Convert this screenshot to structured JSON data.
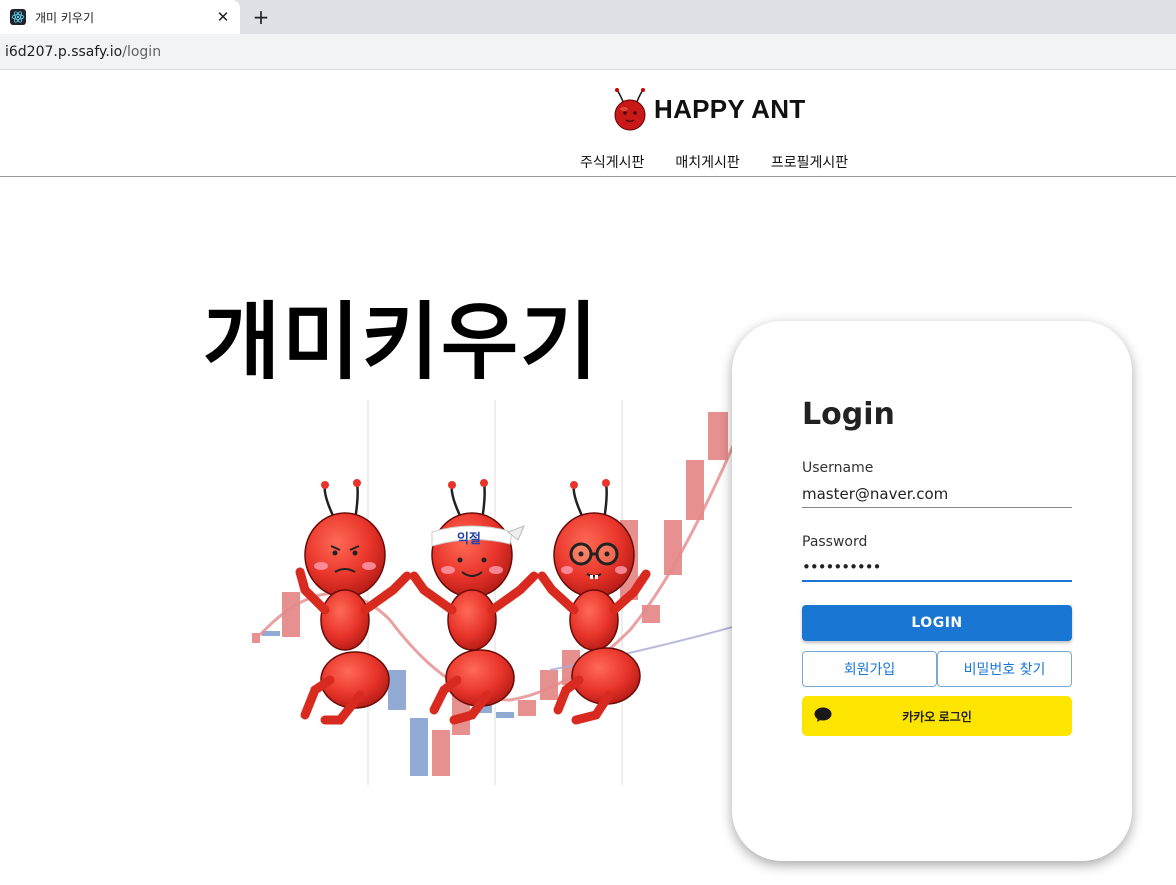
{
  "browser": {
    "tab_title": "개미 키우기",
    "tab_close": "✕",
    "new_tab": "+",
    "url_host": "i6d207.p.ssafy.io",
    "url_path": "/login"
  },
  "header": {
    "brand": "HAPPY ANT",
    "nav": [
      "주식게시판",
      "매치게시판",
      "프로필게시판"
    ]
  },
  "hero": {
    "title": "개미키우기",
    "headband_text": "익절"
  },
  "login": {
    "title": "Login",
    "username_label": "Username",
    "username_value": "master@naver.com",
    "password_label": "Password",
    "password_value": "••••••••••",
    "login_button": "LOGIN",
    "signup_button": "회원가입",
    "find_password_button": "비밀번호 찾기",
    "kakao_button": "카카오 로그인"
  },
  "colors": {
    "primary": "#1976d2",
    "kakao": "#fee500",
    "ant_red": "#e8342a"
  }
}
